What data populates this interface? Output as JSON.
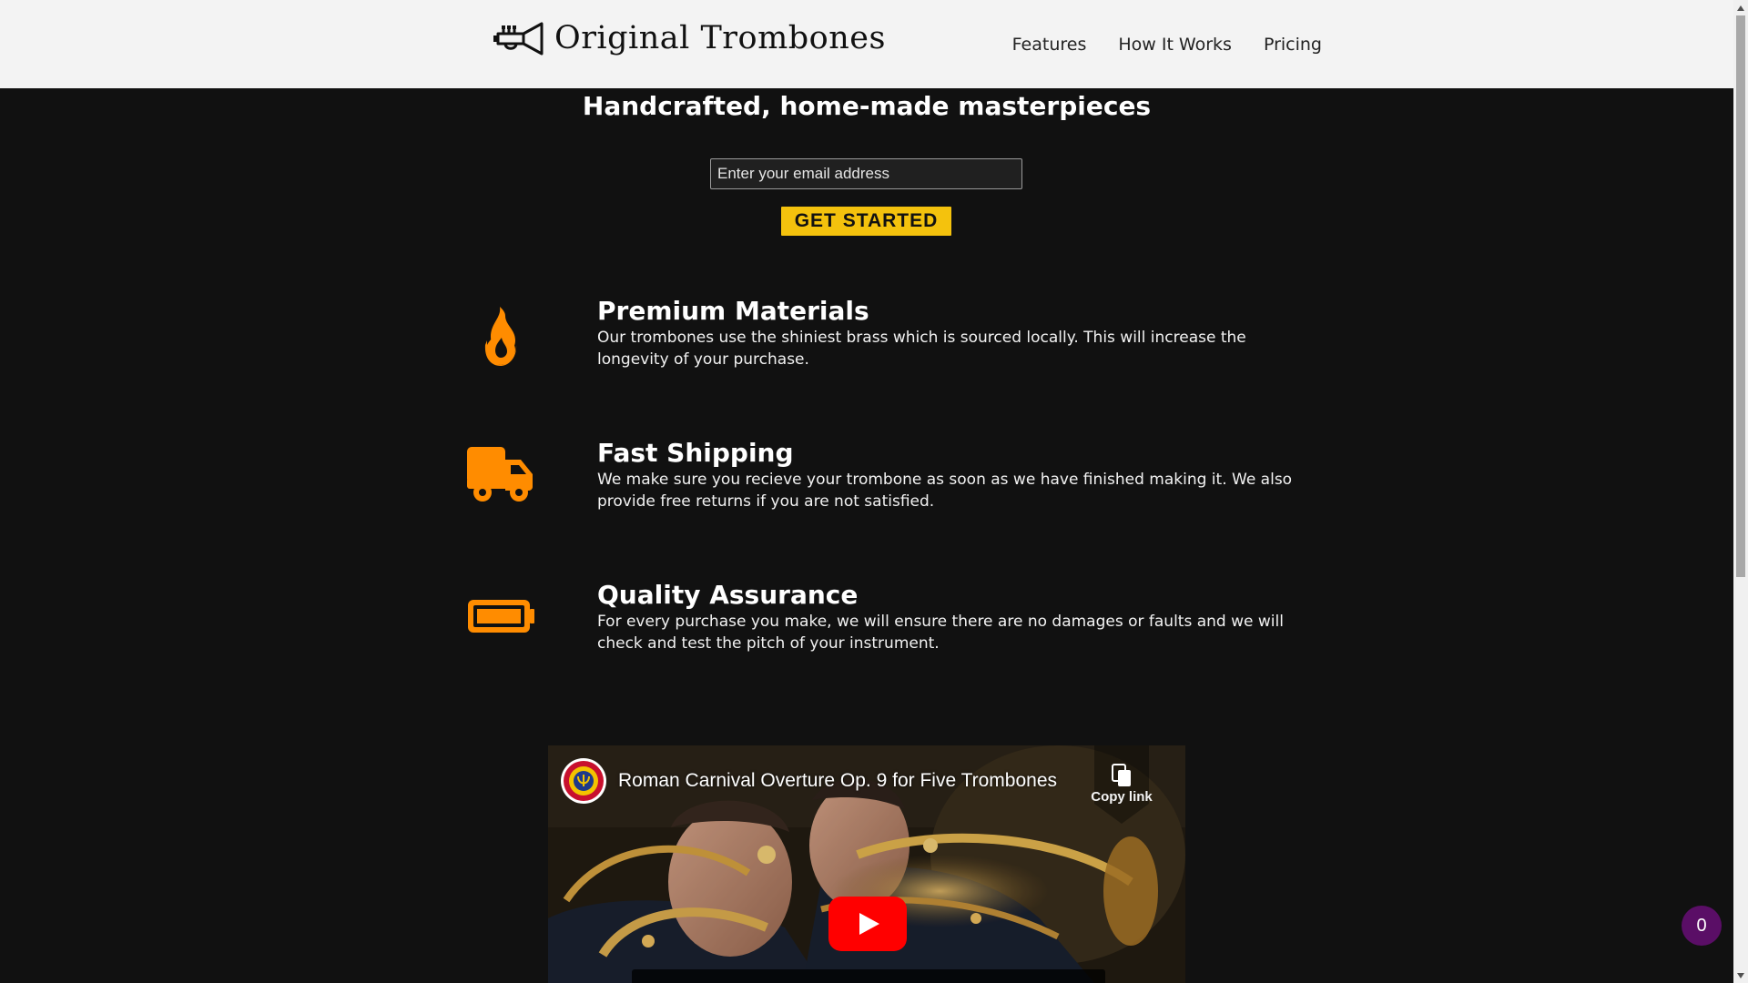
{
  "header": {
    "logo_text": "Original Trombones",
    "logo_icon": "trumpet-icon",
    "nav": [
      {
        "label": "Features"
      },
      {
        "label": "How It Works"
      },
      {
        "label": "Pricing"
      }
    ]
  },
  "hero": {
    "title": "Handcrafted, home-made masterpieces",
    "email_placeholder": "Enter your email address",
    "cta_label": "GET STARTED"
  },
  "features": [
    {
      "icon": "fire-icon",
      "title": "Premium Materials",
      "description": "Our trombones use the shiniest brass which is sourced locally. This will increase the longevity of your purchase."
    },
    {
      "icon": "truck-icon",
      "title": "Fast Shipping",
      "description": "We make sure you recieve your trombone as soon as we have finished making it. We also provide free returns if you are not satisfied."
    },
    {
      "icon": "battery-icon",
      "title": "Quality Assurance",
      "description": "For every purchase you make, we will ensure there are no damages or faults and we will check and test the pitch of your instrument."
    }
  ],
  "video": {
    "title": "Roman Carnival Overture Op. 9 for Five Trombones",
    "copy_link_label": "Copy link"
  },
  "cart": {
    "count": "0"
  },
  "colors": {
    "accent_orange": "#ff8c00",
    "cta_yellow": "#f4c20d",
    "badge_purple": "#5a0e66",
    "page_background": "#111111",
    "header_background": "#f3f3f3",
    "youtube_red": "#ff0000"
  }
}
